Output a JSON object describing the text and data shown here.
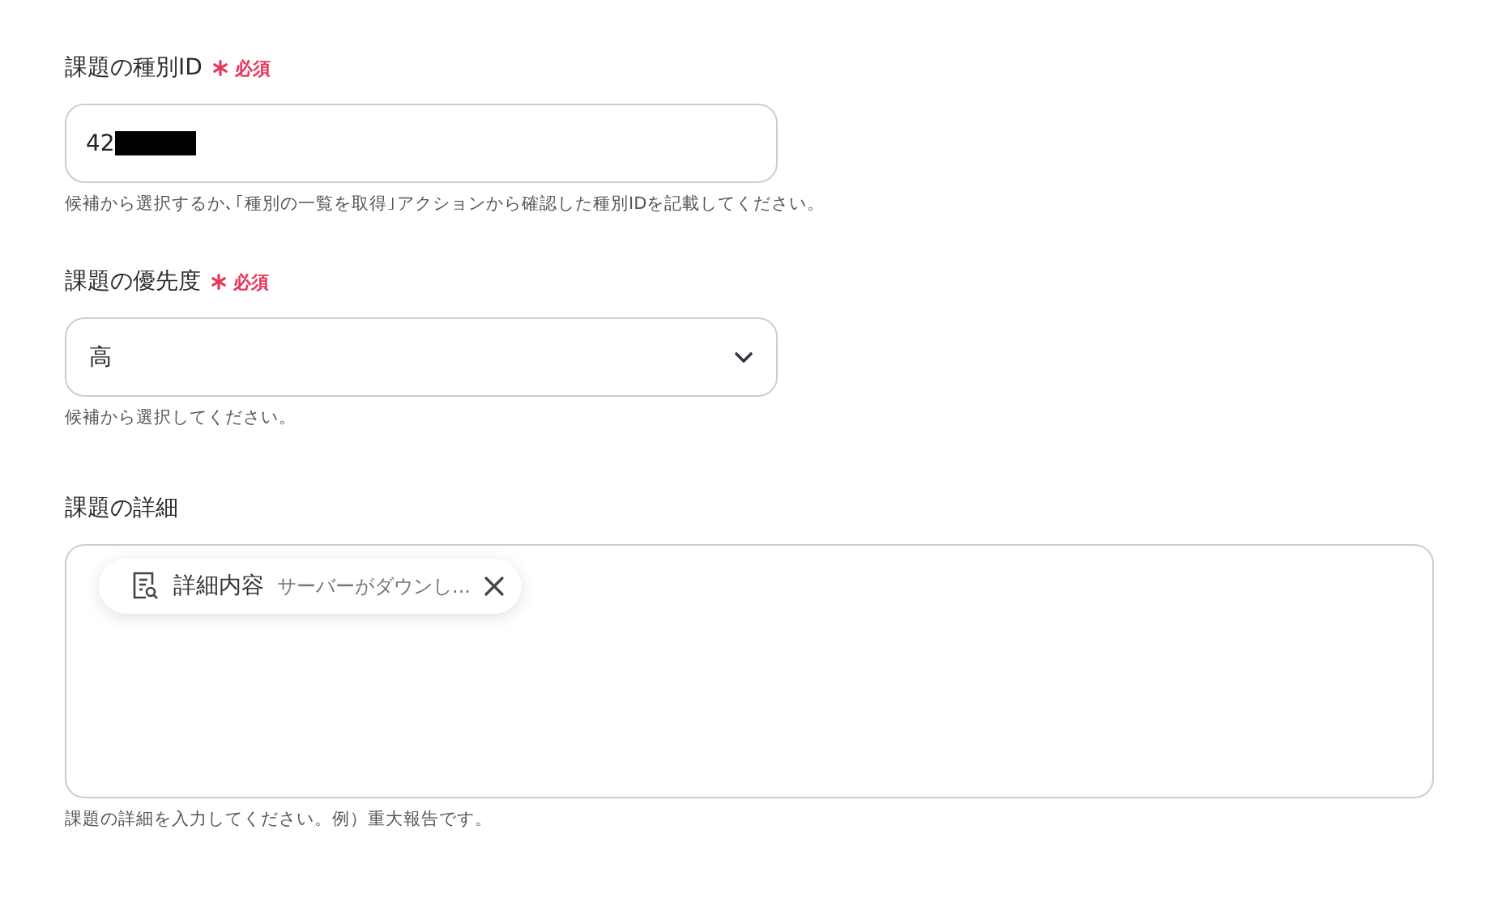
{
  "fields": [
    {
      "kind": "text",
      "label": "課題の種別ID",
      "required": true,
      "required_text": "必須",
      "value": "42",
      "redacted": true,
      "hint": "候補から選択するか､｢種別の一覧を取得｣アクションから確認した種別IDを記載してください。"
    },
    {
      "kind": "select",
      "label": "課題の優先度",
      "required": true,
      "required_text": "必須",
      "value": "高",
      "hint": "候補から選択してください。"
    },
    {
      "kind": "textarea",
      "label": "課題の詳細",
      "required": false,
      "chips": [
        {
          "name": "詳細内容",
          "preview": "サーバーがダウンし..."
        }
      ],
      "hint": "課題の詳細を入力してください。例）重大報告です。"
    }
  ]
}
